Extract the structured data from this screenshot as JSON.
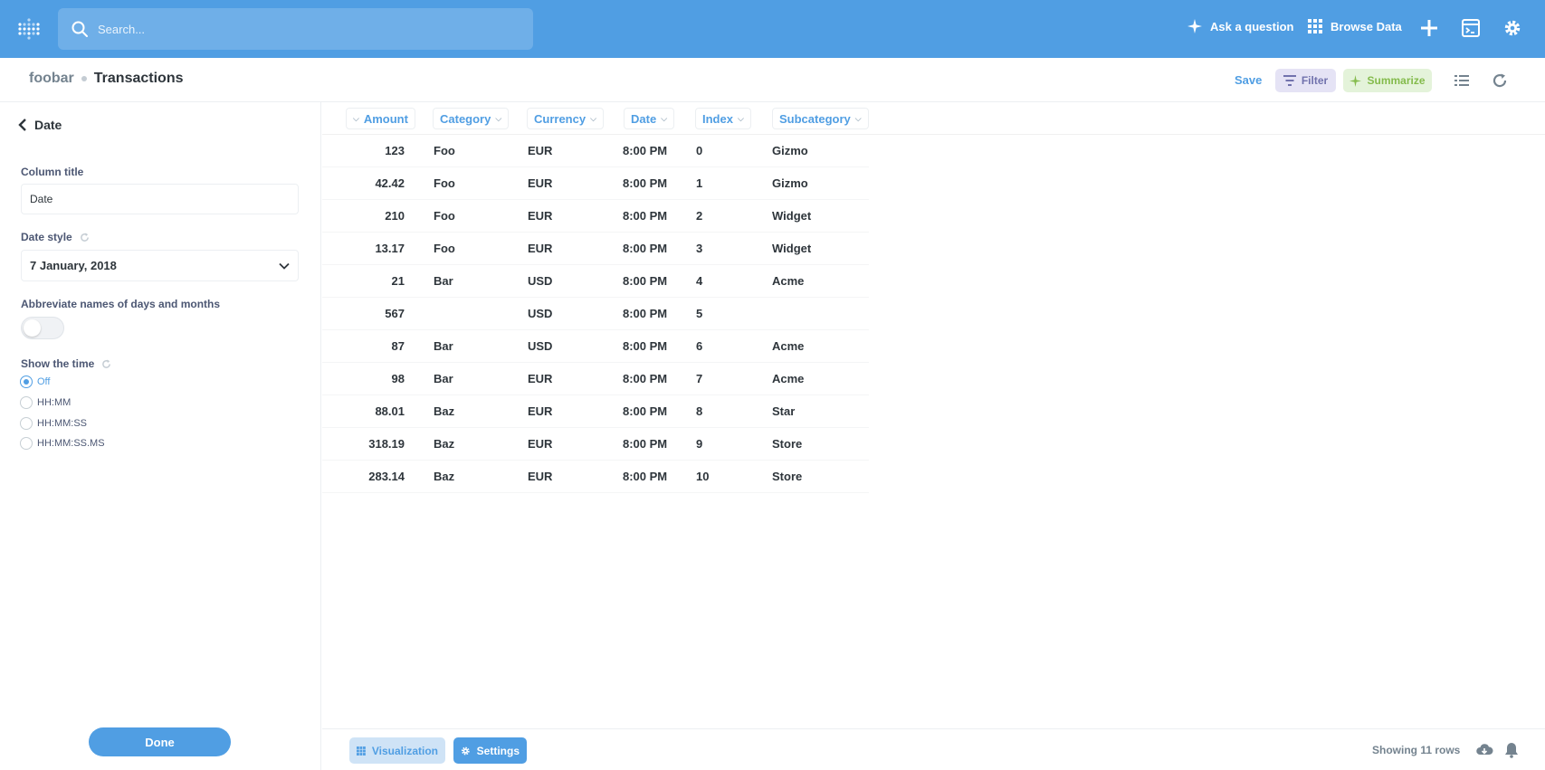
{
  "nav": {
    "search_placeholder": "Search...",
    "ask": "Ask a question",
    "browse": "Browse Data"
  },
  "header": {
    "database": "foobar",
    "table": "Transactions",
    "save": "Save",
    "filter": "Filter",
    "summarize": "Summarize"
  },
  "sidebar": {
    "title": "Date",
    "column_title_label": "Column title",
    "column_title_value": "Date",
    "date_style_label": "Date style",
    "date_style_value": "7 January, 2018",
    "abbreviate_label": "Abbreviate names of days and months",
    "show_time_label": "Show the time",
    "time_options": [
      "Off",
      "HH:MM",
      "HH:MM:SS",
      "HH:MM:SS.MS"
    ],
    "selected_time_option": "Off",
    "done": "Done"
  },
  "table": {
    "columns": [
      "Amount",
      "Category",
      "Currency",
      "Date",
      "Index",
      "Subcategory"
    ],
    "rows": [
      [
        "123",
        "Foo",
        "EUR",
        "8:00 PM",
        "0",
        "Gizmo"
      ],
      [
        "42.42",
        "Foo",
        "EUR",
        "8:00 PM",
        "1",
        "Gizmo"
      ],
      [
        "210",
        "Foo",
        "EUR",
        "8:00 PM",
        "2",
        "Widget"
      ],
      [
        "13.17",
        "Foo",
        "EUR",
        "8:00 PM",
        "3",
        "Widget"
      ],
      [
        "21",
        "Bar",
        "USD",
        "8:00 PM",
        "4",
        "Acme"
      ],
      [
        "567",
        "",
        "USD",
        "8:00 PM",
        "5",
        ""
      ],
      [
        "87",
        "Bar",
        "USD",
        "8:00 PM",
        "6",
        "Acme"
      ],
      [
        "98",
        "Bar",
        "EUR",
        "8:00 PM",
        "7",
        "Acme"
      ],
      [
        "88.01",
        "Baz",
        "EUR",
        "8:00 PM",
        "8",
        "Star"
      ],
      [
        "318.19",
        "Baz",
        "EUR",
        "8:00 PM",
        "9",
        "Store"
      ],
      [
        "283.14",
        "Baz",
        "EUR",
        "8:00 PM",
        "10",
        "Store"
      ]
    ]
  },
  "footer": {
    "visualization": "Visualization",
    "settings": "Settings",
    "row_count": "Showing 11 rows"
  },
  "colors": {
    "brand": "#509ee3",
    "filter": "#7172ad",
    "summarize": "#84bb4c"
  }
}
